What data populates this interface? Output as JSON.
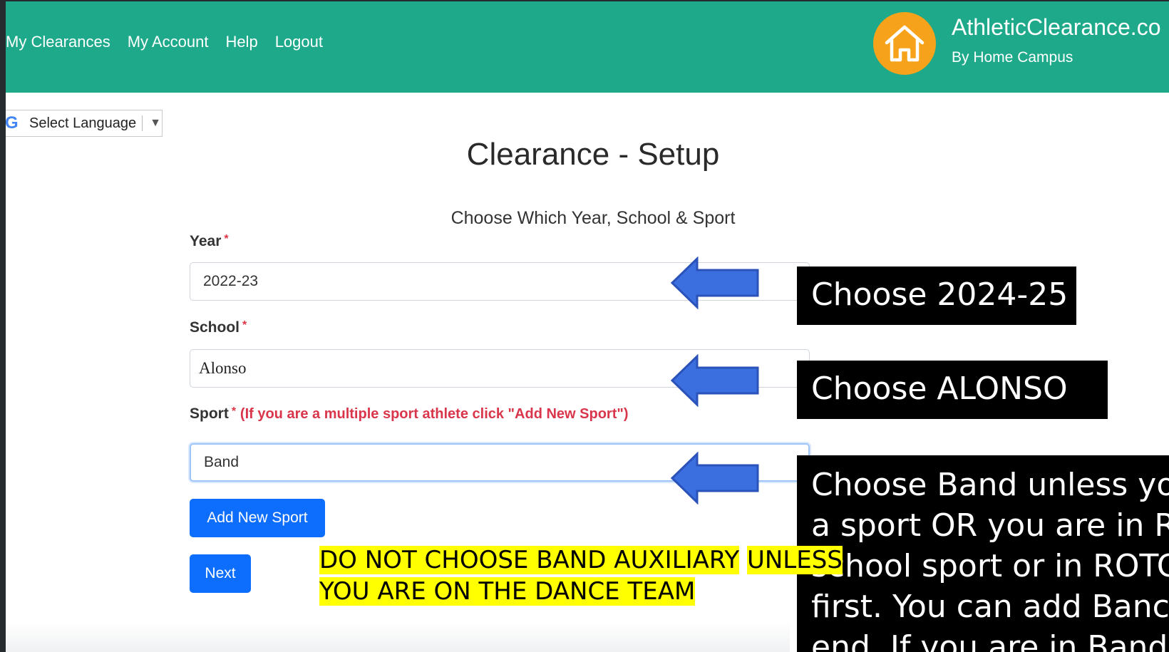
{
  "nav": {
    "links": [
      "My Clearances",
      "My Account",
      "Help",
      "Logout"
    ]
  },
  "brand": {
    "title": "AthleticClearance.co",
    "subtitle": "By Home Campus",
    "logo_icon": "house-icon",
    "logo_color": "#f7a21b"
  },
  "language": {
    "g_glyph": "G",
    "label": "Select Language",
    "arrow": "▼"
  },
  "page": {
    "title": "Clearance - Setup",
    "subtitle": "Choose Which Year, School & Sport"
  },
  "form": {
    "year": {
      "label": "Year",
      "required": "*",
      "value": "2022-23"
    },
    "school": {
      "label": "School",
      "required": "*",
      "value": "Alonso"
    },
    "sport": {
      "label": "Sport",
      "required": "*",
      "note": "(If you are a multiple sport athlete click \"Add New Sport\")",
      "value": "Band"
    },
    "add_sport_label": "Add New Sport",
    "next_label": "Next"
  },
  "annotations": {
    "callout_year": "Choose 2024-25",
    "callout_school": "Choose ALONSO",
    "callout_band_lines": [
      "Choose Band unless you",
      "a sport OR you are in R",
      "school sport or in ROTC",
      "first.  You can add Banc",
      "end.  If you are in Band"
    ],
    "highlight_line1_a": "DO NOT CHOOSE BAND AUXILIARY",
    "highlight_line1_b": "UNLESS",
    "highlight_line2": "YOU ARE ON THE DANCE TEAM"
  },
  "colors": {
    "header": "#1da98a",
    "primary_button": "#0d6efd",
    "required": "#dc3545",
    "arrow": "#3b6fe0",
    "highlight": "#ffff00"
  }
}
